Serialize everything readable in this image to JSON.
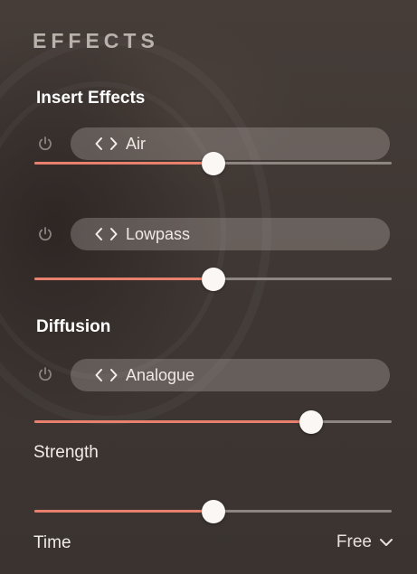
{
  "header": {
    "title": "EFFECTS"
  },
  "insert_effects": {
    "heading": "Insert Effects",
    "slots": [
      {
        "name": "Air",
        "power_icon": "power-icon",
        "level": 0.5
      },
      {
        "name": "Lowpass",
        "power_icon": "power-icon",
        "level": 0.5
      }
    ]
  },
  "diffusion": {
    "heading": "Diffusion",
    "type": {
      "name": "Analogue",
      "power_icon": "power-icon"
    },
    "type_level": 0.775,
    "strength": {
      "label": "Strength",
      "level": 0.5
    },
    "time": {
      "label": "Time",
      "mode": "Free"
    }
  },
  "colors": {
    "accent": "#e8806e",
    "track": "#8d8581",
    "thumb": "#fbf7f4",
    "selector_bg": "#8a817c"
  }
}
